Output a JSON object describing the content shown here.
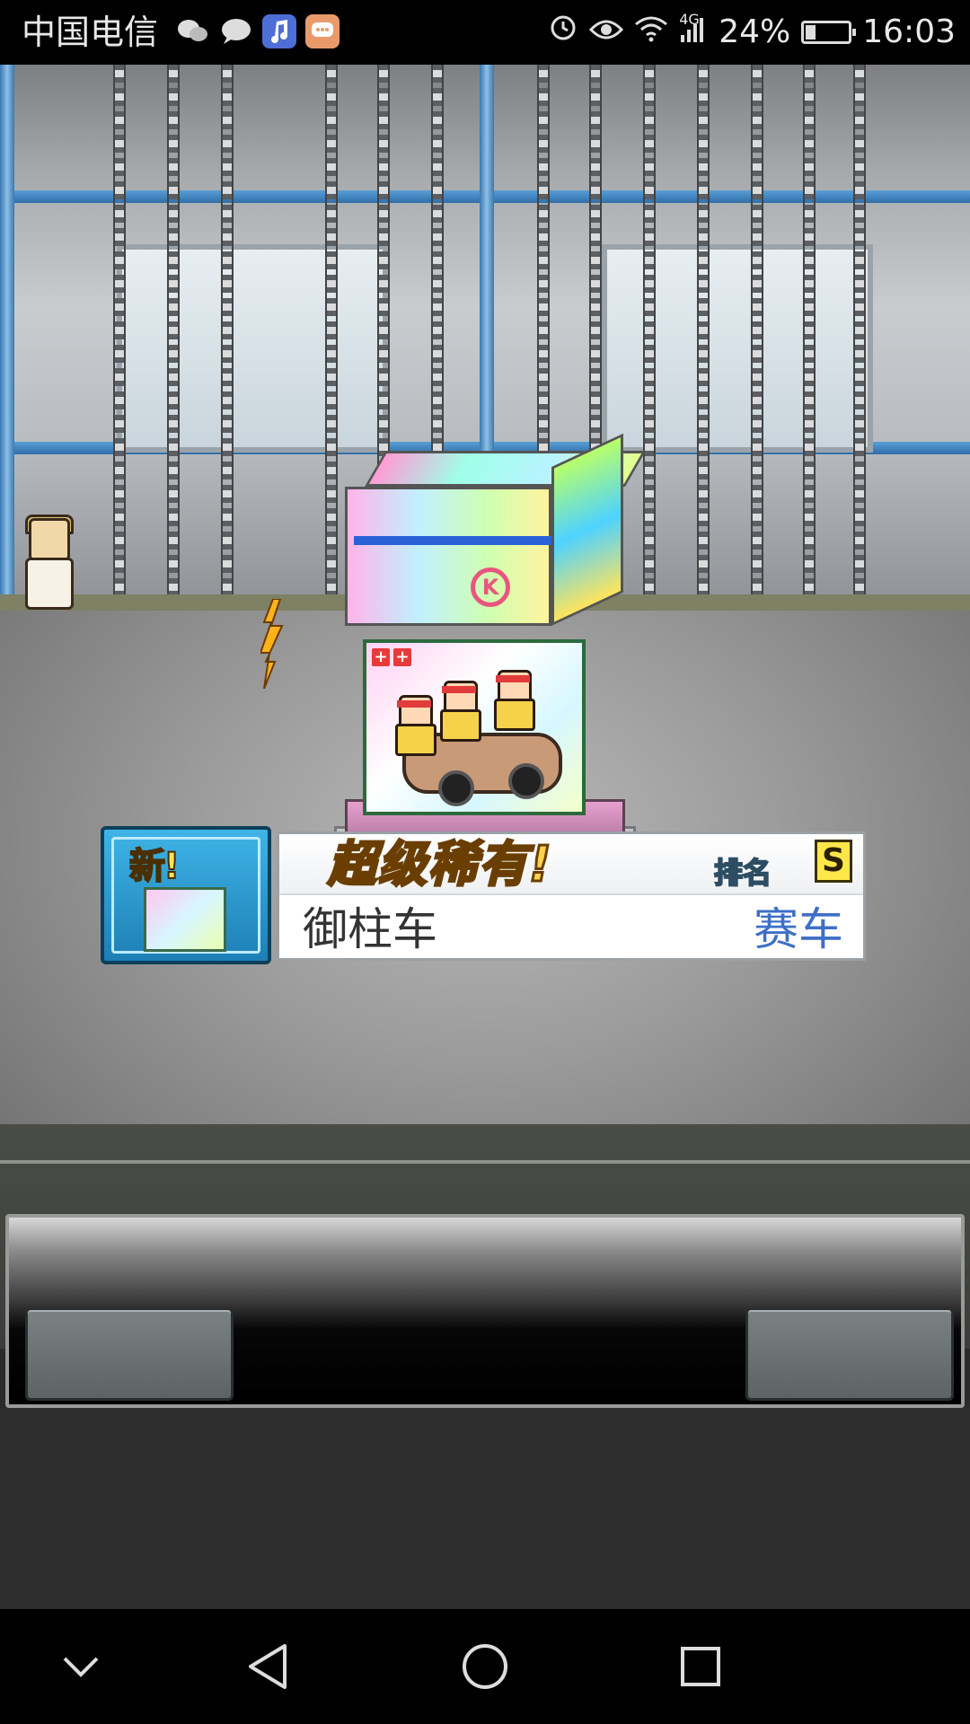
{
  "status_bar": {
    "carrier": "中国电信",
    "network": "4G",
    "battery": "24%",
    "battery_level": 0.24,
    "time": "16:03",
    "icons": [
      "wechat-icon",
      "message-icon",
      "music-icon",
      "chat-icon",
      "alarm-icon",
      "eye-icon",
      "wifi-icon",
      "signal-icon",
      "battery-icon"
    ]
  },
  "banner": {
    "new_label": "新!",
    "rarity": "超级稀有!",
    "rank_label": "排名",
    "rank_value": "S",
    "item_name": "御柱车",
    "item_type": "赛车"
  },
  "item_card": {
    "tags": [
      "+",
      "+"
    ]
  },
  "navbar": {
    "icons": [
      "chevron-down-icon",
      "back-icon",
      "home-icon",
      "recents-icon"
    ]
  },
  "colors": {
    "rarity_gold": "#ffd34a",
    "type_blue": "#3e6fc7",
    "thumb_blue": "#3fb4e6"
  }
}
